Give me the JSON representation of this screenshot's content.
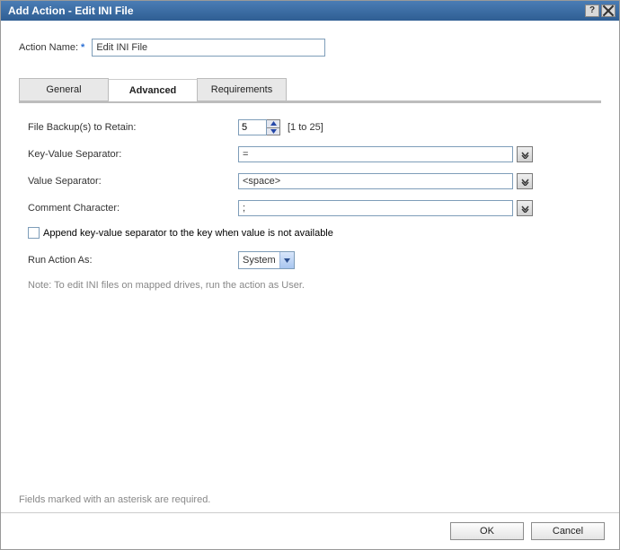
{
  "title": "Add Action - Edit INI File",
  "name_label": "Action Name:",
  "name_value": "Edit INI File",
  "tabs": [
    "General",
    "Advanced",
    "Requirements"
  ],
  "active_tab": 1,
  "fields": {
    "backup_label": "File Backup(s) to Retain:",
    "backup_value": "5",
    "backup_range": "[1 to 25]",
    "kv_sep_label": "Key-Value Separator:",
    "kv_sep_value": "=",
    "val_sep_label": "Value Separator:",
    "val_sep_value": "<space>",
    "comment_label": "Comment Character:",
    "comment_value": ";",
    "append_label": "Append key-value separator to the key when value is not available",
    "runas_label": "Run Action As:",
    "runas_value": "System",
    "note": "Note: To edit INI files on mapped drives, run the action as User."
  },
  "required_note": "Fields marked with an asterisk are required.",
  "buttons": {
    "ok": "OK",
    "cancel": "Cancel"
  }
}
